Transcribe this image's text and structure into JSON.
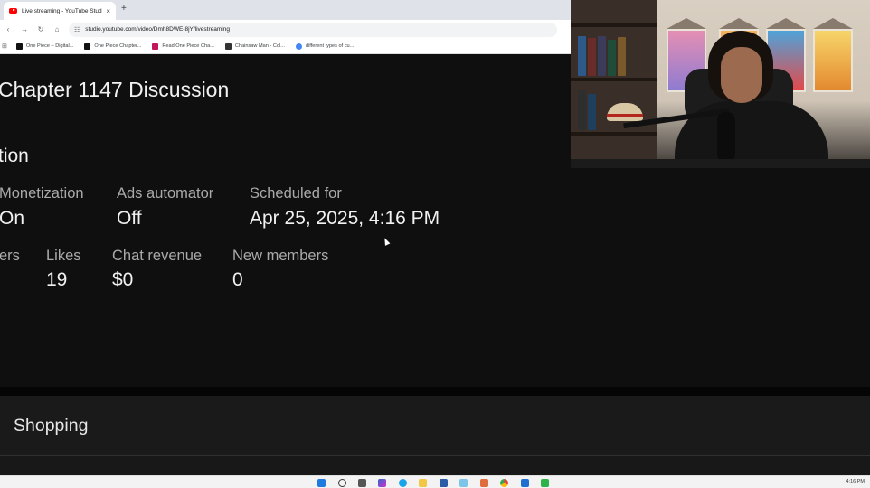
{
  "browser": {
    "tab_title": "Live streaming - YouTube Studio",
    "tab_close": "×",
    "new_tab": "+",
    "url": "studio.youtube.com/video/Dmh8DWE-8jY/livestreaming",
    "bookmarks": [
      {
        "label": "One Piece – Digital...",
        "color": "#111111"
      },
      {
        "label": "One Piece Chapter...",
        "color": "#111111"
      },
      {
        "label": "Read One Piece Cha...",
        "color": "#c2185b"
      },
      {
        "label": "Chainsaw Man - Col...",
        "color": "#333333"
      },
      {
        "label": "different types of cu...",
        "color": "#4285f4"
      }
    ]
  },
  "page": {
    "title": "Chapter 1147 Discussion",
    "section_title": "tion",
    "stats_row1": [
      {
        "label": "Monetization",
        "value": "On"
      },
      {
        "label": "Ads automator",
        "value": "Off"
      },
      {
        "label": "Scheduled for",
        "value": "Apr 25, 2025, 4:16 PM"
      }
    ],
    "stats_row2": [
      {
        "label": "ers",
        "value": ""
      },
      {
        "label": "Likes",
        "value": "19"
      },
      {
        "label": "Chat revenue",
        "value": "$0"
      },
      {
        "label": "New members",
        "value": "0"
      }
    ],
    "shopping_title": "Shopping"
  },
  "taskbar": {
    "clock": "4:16 PM"
  }
}
